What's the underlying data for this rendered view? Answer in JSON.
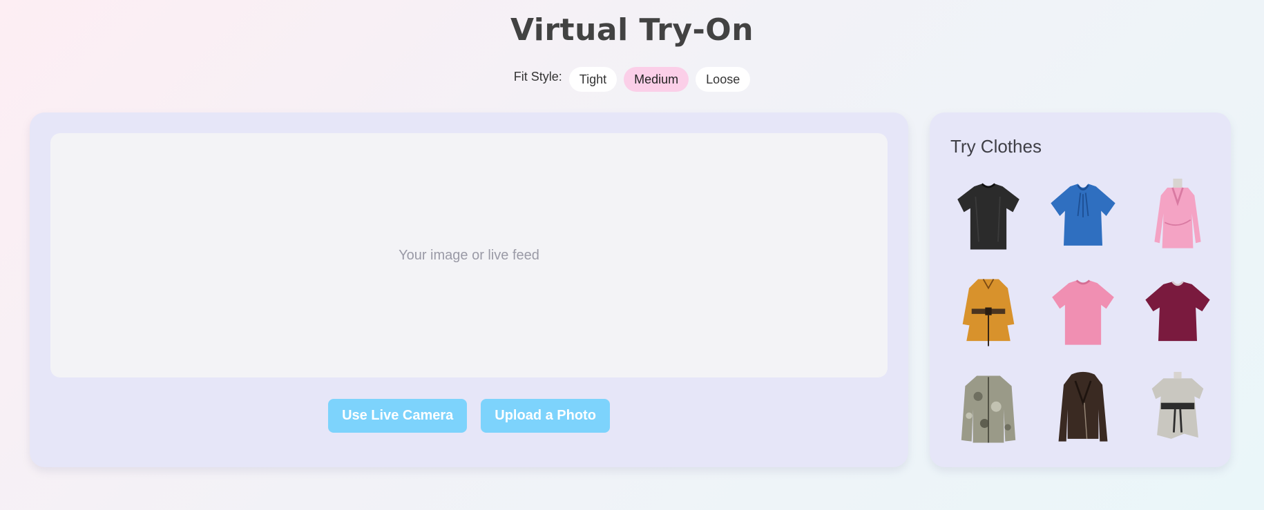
{
  "header": {
    "title": "Virtual Try-On"
  },
  "fit_style": {
    "label": "Fit Style:",
    "options": [
      "Tight",
      "Medium",
      "Loose"
    ],
    "selected": "Medium"
  },
  "main": {
    "preview_placeholder": "Your image or live feed",
    "buttons": {
      "camera": "Use Live Camera",
      "upload": "Upload a Photo"
    }
  },
  "sidebar": {
    "title": "Try Clothes",
    "items": [
      {
        "icon": "black-tshirt-icon",
        "color": "#2b2b2b"
      },
      {
        "icon": "blue-blouse-icon",
        "color": "#2f6fc0"
      },
      {
        "icon": "pink-blazer-dress-icon",
        "color": "#f4a3c4"
      },
      {
        "icon": "mustard-belted-dress-icon",
        "color": "#d8922c"
      },
      {
        "icon": "pink-tshirt-icon",
        "color": "#f08fb2"
      },
      {
        "icon": "maroon-tshirt-icon",
        "color": "#7a1a3e"
      },
      {
        "icon": "camo-jacket-icon",
        "color": "#8f8f7e"
      },
      {
        "icon": "leather-jacket-icon",
        "color": "#3a2a22"
      },
      {
        "icon": "grey-belted-top-icon",
        "color": "#c9c7c0"
      }
    ]
  },
  "colors": {
    "panel_bg": "#e6e6f8",
    "preview_bg": "#f3f3f6",
    "button_bg": "#7dd3fc",
    "active_pill": "#fbcfe8"
  }
}
